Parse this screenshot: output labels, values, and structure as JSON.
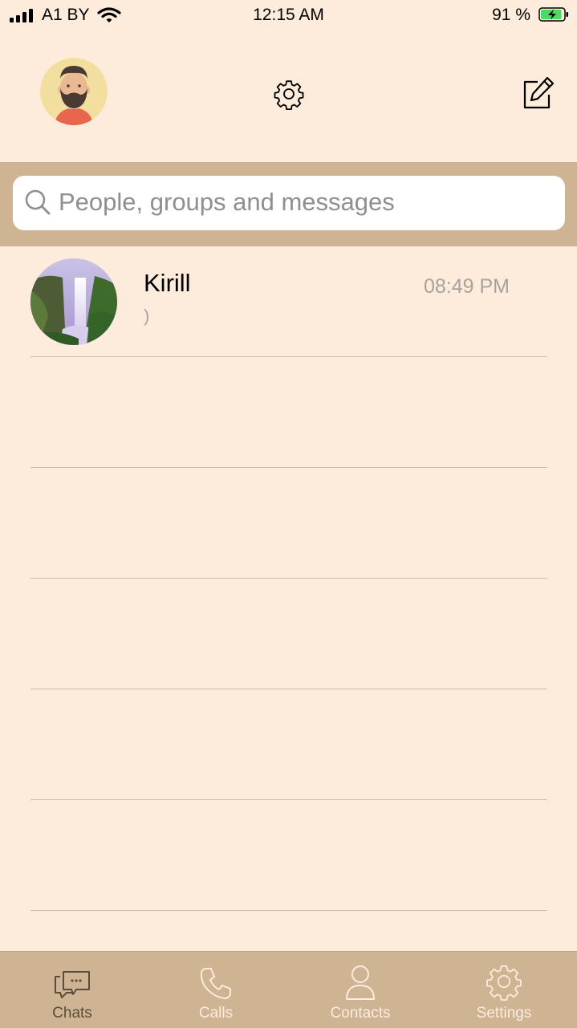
{
  "status_bar": {
    "carrier": "A1 BY",
    "time": "12:15 AM",
    "battery_percent": "91 %",
    "battery_level": 0.91
  },
  "header": {
    "profile_avatar": "bearded-man-avatar",
    "settings_icon": "gear-icon",
    "compose_icon": "compose-icon"
  },
  "search": {
    "placeholder": "People, groups and messages",
    "value": ""
  },
  "chats": [
    {
      "name": "Kirill",
      "time": "08:49 PM",
      "preview": ")",
      "avatar": "waterfall-photo"
    }
  ],
  "tabs": [
    {
      "label": "Chats",
      "icon": "chat-bubbles-icon"
    },
    {
      "label": "Calls",
      "icon": "phone-icon"
    },
    {
      "label": "Contacts",
      "icon": "person-icon"
    },
    {
      "label": "Settings",
      "icon": "gear-icon"
    }
  ],
  "colors": {
    "background": "#fdebdc",
    "accent": "#cfb493",
    "tab_icon": "#fdebdc",
    "battery_fill": "#4cd964"
  }
}
